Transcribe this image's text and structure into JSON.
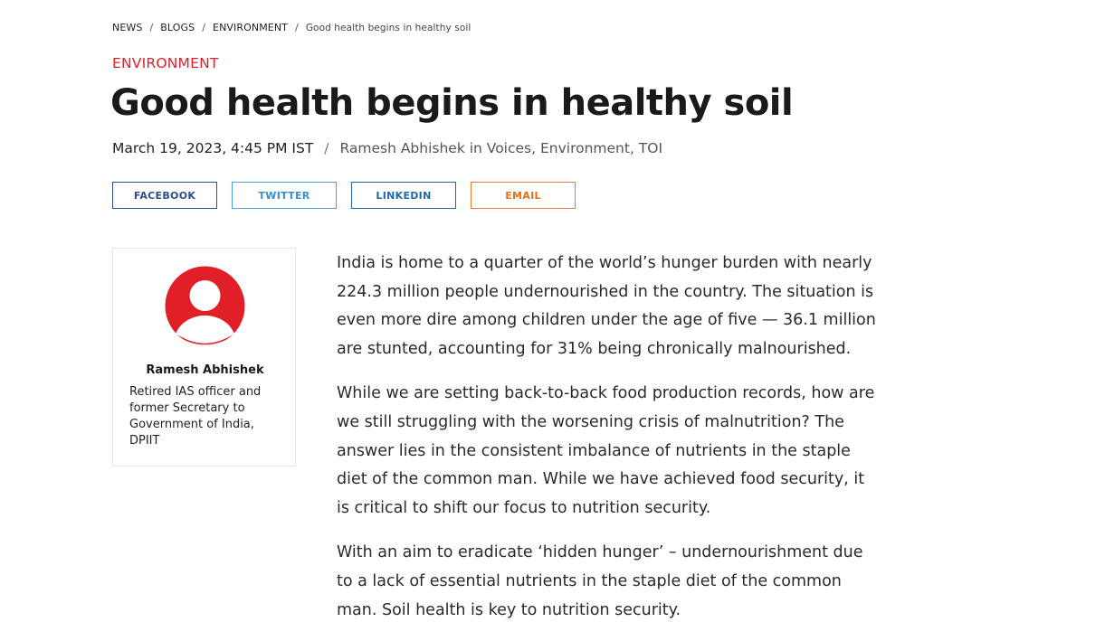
{
  "breadcrumb": {
    "items": [
      "NEWS",
      "BLOGS",
      "ENVIRONMENT"
    ],
    "separator": "/",
    "current": "Good health begins in healthy soil"
  },
  "article": {
    "category": "ENVIRONMENT",
    "title": "Good health begins in healthy soil",
    "date": "March 19, 2023, 4:45 PM IST",
    "meta_separator": "/",
    "byline": "Ramesh Abhishek in Voices, Environment, TOI",
    "paragraphs": [
      "India is home to a quarter of the world’s hunger burden with nearly 224.3 million people undernourished in the country. The situation is even more dire among children under the age of five — 36.1 million are stunted, accounting for 31% being chronically malnourished.",
      "While we are setting back-to-back food production records, how are we still struggling with the worsening crisis of malnutrition? The answer lies in the consistent imbalance of nutrients in the staple diet of the common man. While we have achieved food security, it is critical to shift our focus to nutrition security.",
      "With an aim to eradicate ‘hidden hunger’ – undernourishment due to a lack of essential nutrients in the staple diet of the common man. Soil health is key to nutrition security."
    ]
  },
  "share": {
    "facebook": "FACEBOOK",
    "twitter": "TWITTER",
    "linkedin": "LINKEDIN",
    "email": "EMAIL"
  },
  "author": {
    "name": "Ramesh Abhishek",
    "bio": "Retired IAS officer and former Secretary to Government of India, DPIIT",
    "avatar_icon": "user-silhouette-icon"
  },
  "colors": {
    "accent_red": "#d8242c",
    "facebook": "#2d4f8c",
    "twitter": "#4aa3d8",
    "linkedin": "#1e6aa8",
    "email": "#ee7b27"
  }
}
